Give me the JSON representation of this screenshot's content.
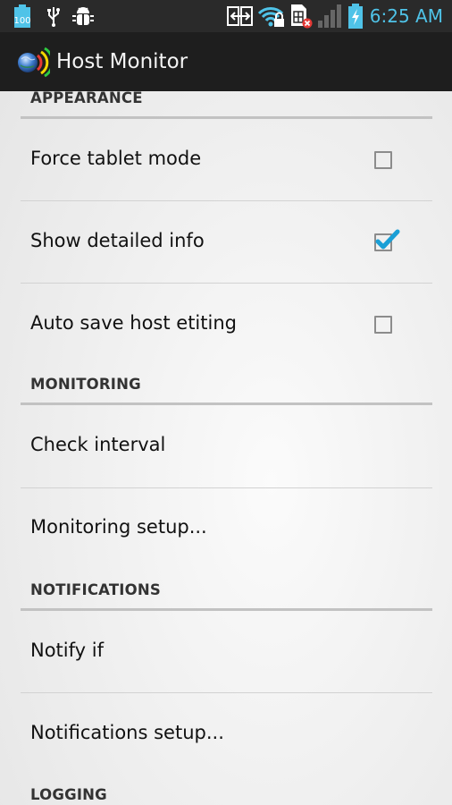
{
  "status_bar": {
    "battery_level_badge": "100",
    "icons": [
      "battery-100-icon",
      "usb-icon",
      "android-debug-icon",
      "screen-mirror-icon",
      "wifi-locked-icon",
      "sim-error-icon",
      "signal-icon",
      "battery-charging-icon"
    ],
    "time": "6:25 AM",
    "accent_color": "#4fc3e8"
  },
  "action_bar": {
    "title": "Host Monitor"
  },
  "settings": {
    "categories": [
      {
        "title": "APPEARANCE",
        "items": [
          {
            "label": "Force tablet mode",
            "type": "checkbox",
            "checked": false
          },
          {
            "label": "Show detailed info",
            "type": "checkbox",
            "checked": true
          },
          {
            "label": "Auto save host etiting",
            "type": "checkbox",
            "checked": false
          }
        ]
      },
      {
        "title": "MONITORING",
        "items": [
          {
            "label": "Check interval",
            "type": "preference"
          },
          {
            "label": "Monitoring setup...",
            "type": "preference"
          }
        ]
      },
      {
        "title": "NOTIFICATIONS",
        "items": [
          {
            "label": "Notify if",
            "type": "preference"
          },
          {
            "label": "Notifications setup...",
            "type": "preference"
          }
        ]
      },
      {
        "title": "LOGGING",
        "items": []
      }
    ],
    "check_color": "#1a9fd6"
  }
}
